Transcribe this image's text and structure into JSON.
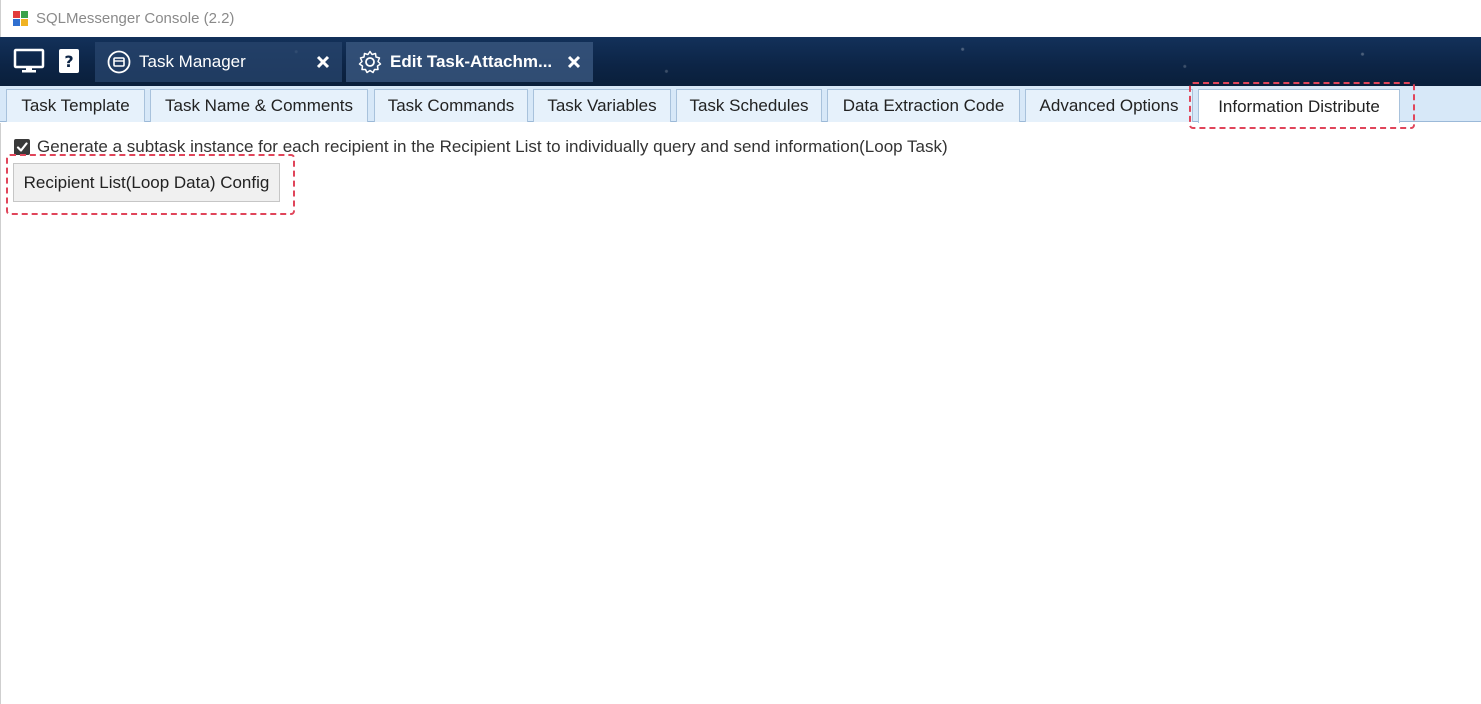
{
  "window": {
    "title": "SQLMessenger Console (2.2)",
    "logo_icon": "puzzle-logo-icon"
  },
  "nav": {
    "monitor_icon": "monitor-icon",
    "help_icon": "help-icon",
    "doc_tabs": [
      {
        "label": "Task Manager",
        "icon": "task-manager-icon",
        "close": "close-icon"
      },
      {
        "label": "Edit Task-Attachm...",
        "icon": "gear-icon",
        "close": "close-icon"
      }
    ]
  },
  "property_tabs": [
    {
      "label": "Task Template"
    },
    {
      "label": "Task Name & Comments"
    },
    {
      "label": "Task Commands"
    },
    {
      "label": "Task Variables"
    },
    {
      "label": "Task Schedules"
    },
    {
      "label": "Data Extraction Code"
    },
    {
      "label": "Advanced Options"
    },
    {
      "label": "Information Distribute",
      "active": true
    }
  ],
  "content": {
    "loop_checkbox_label": "Generate a subtask instance for each recipient in the Recipient List to individually query and send information(Loop Task)",
    "loop_checkbox_checked": true,
    "config_button_label": "Recipient List(Loop Data) Config"
  },
  "colors": {
    "highlight": "#e0455a",
    "nav_bg": "#0c2445",
    "tab_strip_bg": "#d7e8f8"
  }
}
